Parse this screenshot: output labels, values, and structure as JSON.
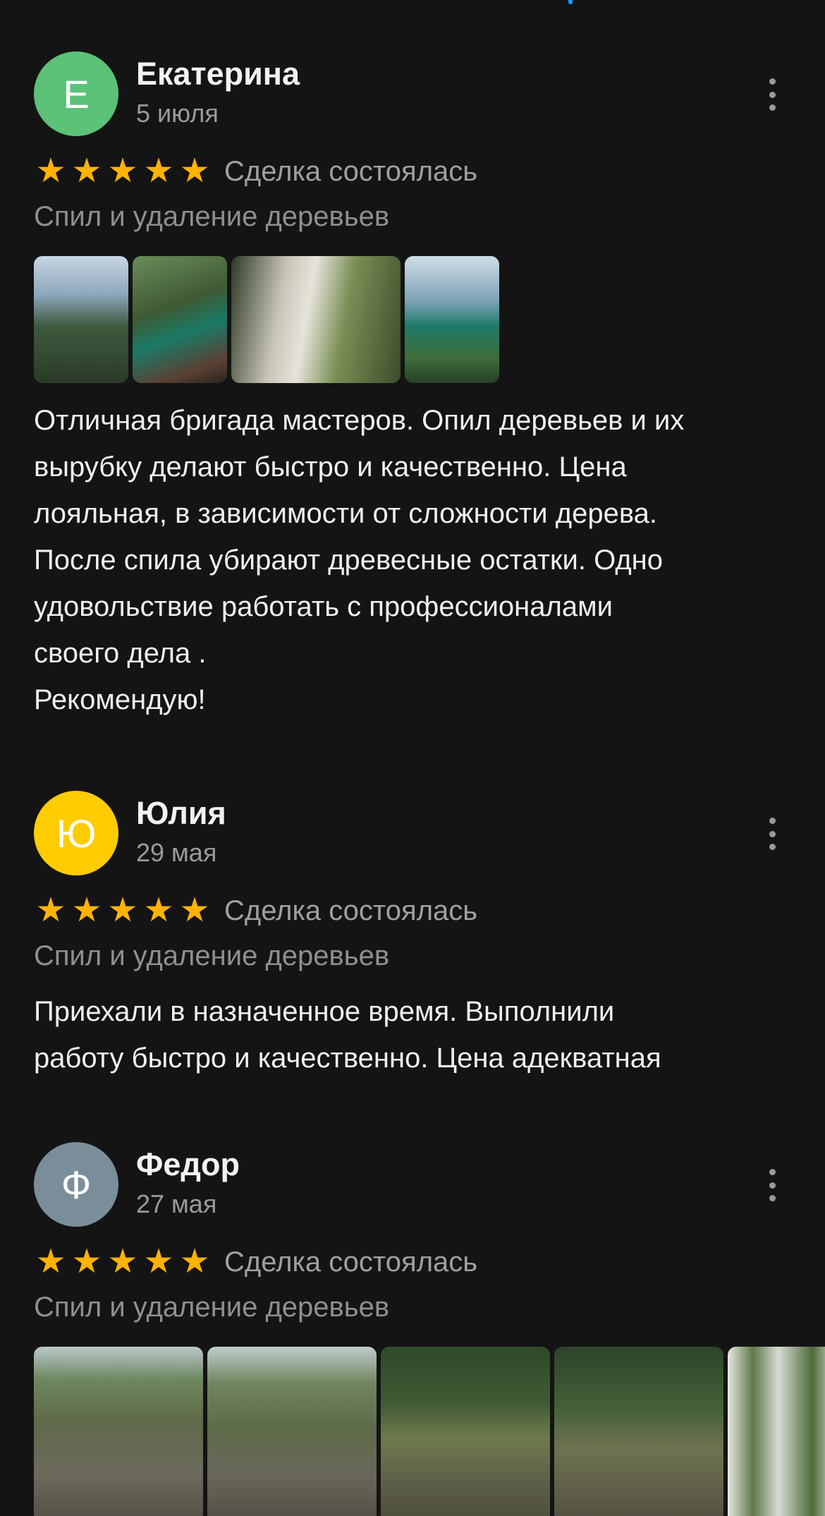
{
  "reviews": [
    {
      "initial": "Е",
      "avatar_color": "#5cc278",
      "author": "Екатерина",
      "date": "5 июля",
      "stars": 5,
      "deal": "Сделка состоялась",
      "category": "Спил и удаление деревьев",
      "text": "Отличная бригада мастеров. Опил деревьев и их\nвырубку делают быстро и качественно. Цена\nлояльная, в зависимости от сложности дерева.\nПосле спила убирают древесные остатки. Одно\nудовольствие работать  с профессионалами\nсвоего дела .\nРекомендую!"
    },
    {
      "initial": "Ю",
      "avatar_color": "#ffcc00",
      "author": "Юлия",
      "date": "29 мая",
      "stars": 5,
      "deal": "Сделка состоялась",
      "category": "Спил и удаление деревьев",
      "text": "Приехали в назначенное время. Выполнили\nработу быстро и качественно. Цена адекватная"
    },
    {
      "initial": "Ф",
      "avatar_color": "#7a8e9a",
      "author": "Федор",
      "date": "27 мая",
      "stars": 5,
      "deal": "Сделка состоялась",
      "category": "Спил и удаление деревьев",
      "text": ""
    }
  ],
  "icons": {
    "star": "star-icon",
    "menu": "more-vertical-icon"
  }
}
